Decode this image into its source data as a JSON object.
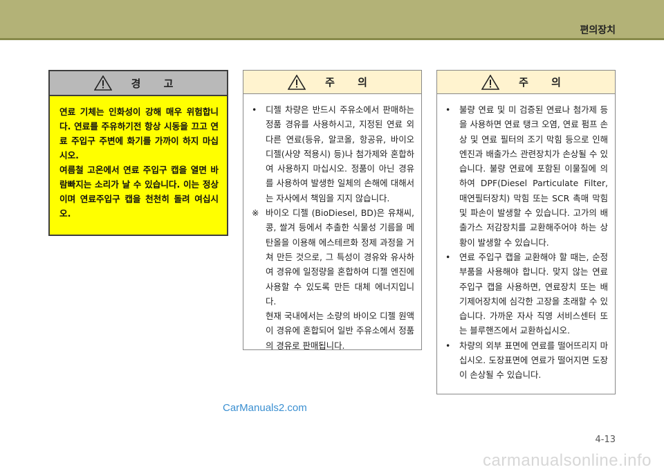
{
  "header": {
    "section": "편의장치"
  },
  "warning": {
    "title": "경 고",
    "paragraphs": [
      "연료 기체는 인화성이 강해 매우 위험합니다. 연료를 주유하기전 항상 시동을 끄고 연료 주입구 주변에 화기를 가까이 하지 마십시오.",
      "여름철 고온에서 연료 주입구 캡을 열면 바람빠지는 소리가 날 수 있습니다. 이는 정상이며 연료주입구 캡을 천천히 돌려 여십시오."
    ]
  },
  "caution1": {
    "title": "주 의",
    "items": [
      {
        "mark": "•",
        "text": "디젤 차량은 반드시 주유소에서 판매하는 정품 경유를 사용하시고, 지정된 연료 외 다른 연료(등유, 알코올, 항공유, 바이오 디젤(사양 적용시) 등)나 첨가제와 혼합하여 사용하지 마십시오. 정품이 아닌 경유를 사용하여 발생한 일체의 손해에 대해서는 자사에서 책임을 지지 않습니다."
      },
      {
        "mark": "※",
        "text": "바이오 디젤 (BioDiesel, BD)은 유채씨, 콩, 쌀겨 등에서 추출한 식물성 기름을 메탄올을 이용해 에스테르화 정제 과정을 거쳐 만든 것으로, 그 특성이 경유와 유사하여 경유에 일정량을 혼합하여 디젤 엔진에 사용할 수 있도록 만든 대체 에너지입니다."
      },
      {
        "mark": "",
        "text": "현재 국내에서는 소량의 바이오 디젤 원액이 경유에 혼합되어 일반 주유소에서 정품의 경유로 판매됩니다."
      }
    ]
  },
  "caution2": {
    "title": "주 의",
    "items": [
      {
        "mark": "•",
        "text": "불량 연료 및 미 검증된 연료나 첨가제 등을 사용하면 연료 탱크 오염, 연료 펌프 손상 및 연료 필터의 조기 막힘 등으로 인해 엔진과 배출가스 관련장치가 손상될 수 있습니다. 불량 연료에 포함된 이물질에 의하여 DPF(Diesel Particulate Filter, 매연필터장치) 막힘 또는 SCR 촉매 막힘 및 파손이 발생할 수 있습니다. 고가의 배출가스 저감장치를 교환해주어야 하는 상황이 발생할 수 있습니다."
      },
      {
        "mark": "•",
        "text": "연료 주입구 캡을 교환해야 할 때는, 순정부품을 사용해야 합니다. 맞지 않는 연료주입구 캡을 사용하면, 연료장치 또는 배기제어장치에 심각한 고장을 초래할 수 있습니다. 가까운 자사 직영 서비스센터 또는 블루핸즈에서 교환하십시오."
      },
      {
        "mark": "•",
        "text": "차량의 외부 표면에 연료를 떨어뜨리지 마십시오. 도장표면에 연료가 떨어지면 도장이 손상될 수 있습니다."
      }
    ]
  },
  "footer": {
    "page_number": "4-13",
    "watermark_left": "CarManuals2.com",
    "watermark_right": "carmanualsonline.info"
  }
}
